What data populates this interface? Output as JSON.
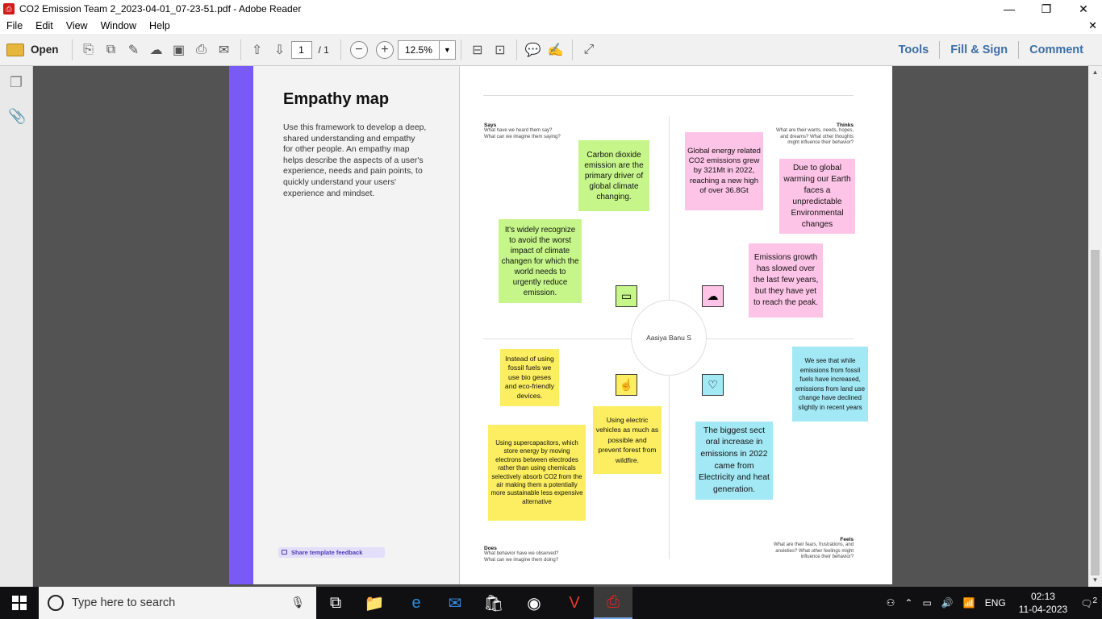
{
  "window": {
    "title": "CO2 Emission Team 2_2023-04-01_07-23-51.pdf - Adobe Reader",
    "minimize": "—",
    "restore": "❐",
    "close": "✕"
  },
  "menu": {
    "items": [
      "File",
      "Edit",
      "View",
      "Window",
      "Help"
    ],
    "close_doc": "✕"
  },
  "toolbar": {
    "open_label": "Open",
    "page_current": "1",
    "page_total": "/ 1",
    "zoom": "12.5%",
    "tools": "Tools",
    "fill_sign": "Fill & Sign",
    "comment": "Comment"
  },
  "panel": {
    "title": "Empathy map",
    "description": "Use this framework to develop a deep, shared understanding and empathy for other people. An empathy map helps describe the aspects of a user's experience, needs and pain points, to quickly understand your users' experience and mindset.",
    "feedback": "Share template feedback"
  },
  "board": {
    "center": "Aasiya Banu S",
    "says": {
      "title": "Says",
      "sub": "What have we heard them say?\nWhat can we imagine them saying?"
    },
    "thinks": {
      "title": "Thinks",
      "sub": "What are their wants, needs, hopes,\nand dreams? What other thoughts\nmight influence their behavior?"
    },
    "does": {
      "title": "Does",
      "sub": "What behavior have we observed?\nWhat can we imagine them doing?"
    },
    "feels": {
      "title": "Feels",
      "sub": "What are their fears, frustrations, and\nanxieties? What other feelings might\ninfluence their behavior?"
    },
    "notes": {
      "says_1": "Carbon dioxide emission are the primary driver of global climate changing.",
      "says_2": "It's widely recognize to avoid the worst impact of climate changen for which the world needs to urgently reduce emission.",
      "thinks_1": "Global energy related CO2 emissions grew by 321Mt in 2022, reaching a new high of over  36.8Gt",
      "thinks_2": "Due to global warming our Earth faces a unpredictable Environmental changes",
      "thinks_3": "Emissions growth has slowed over the last few years, but they have yet to reach the peak.",
      "does_1": "Instead of using fossil fuels we use bio geses  and  eco-friendly devices.",
      "does_2": "Using electric vehicles as much as possible and prevent forest from wildfire.",
      "does_3": "Using supercapacitors, which store energy by moving electrons between electrodes rather than using chemicals selectively absorb CO2 from the air making them a potentially more sustainable less expensive alternative",
      "feels_1": "We see that while emissions from fossil fuels have increased, emissions from land use change have declined slightly in recent years",
      "feels_2": "The biggest sect oral increase in emissions in 2022 came from Electricity and heat generation."
    },
    "colors": {
      "green": "#c6f68a",
      "pink": "#fdc4e7",
      "yellow": "#fcee60",
      "cyan": "#a3e8f5",
      "accent": "#7a5af5"
    }
  },
  "taskbar": {
    "search_placeholder": "Type here to search",
    "language": "ENG",
    "time": "02:13",
    "date": "11-04-2023",
    "notifications": "2"
  }
}
